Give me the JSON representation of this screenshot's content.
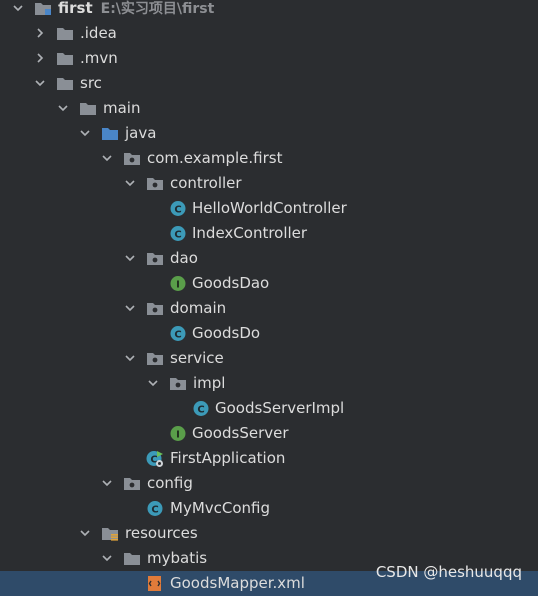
{
  "project": {
    "name": "first",
    "path": "E:\\实习项目\\first"
  },
  "tree": {
    "idea": ".idea",
    "mvn": ".mvn",
    "src": "src",
    "main": "main",
    "java": "java",
    "package": "com.example.first",
    "controller": "controller",
    "hello_controller": "HelloWorldController",
    "index_controller": "IndexController",
    "dao": "dao",
    "goods_dao": "GoodsDao",
    "domain": "domain",
    "goods_do": "GoodsDo",
    "service": "service",
    "impl": "impl",
    "goods_server_impl": "GoodsServerImpl",
    "goods_server": "GoodsServer",
    "first_application": "FirstApplication",
    "config": "config",
    "mymvc_config": "MyMvcConfig",
    "resources": "resources",
    "mybatis": "mybatis",
    "goods_mapper": "GoodsMapper.xml"
  },
  "watermark": "CSDN @heshuuqqq",
  "colors": {
    "background": "#2b2d30",
    "text": "#dcdcdc",
    "folder": "#8a8f96",
    "source_folder": "#4a86c8",
    "class_icon": "#3c9ab8",
    "interface_icon": "#5a9e4a",
    "selection": "#2f4b69"
  },
  "icons": {
    "expanded": "chevron-down-icon",
    "collapsed": "chevron-right-icon",
    "folder": "folder-icon",
    "source_root": "source-folder-icon",
    "package": "package-icon",
    "resources": "resources-folder-icon",
    "class": "class-icon",
    "interface": "interface-icon",
    "spring_boot_app": "spring-boot-application-icon",
    "xml_file": "xml-file-icon"
  }
}
